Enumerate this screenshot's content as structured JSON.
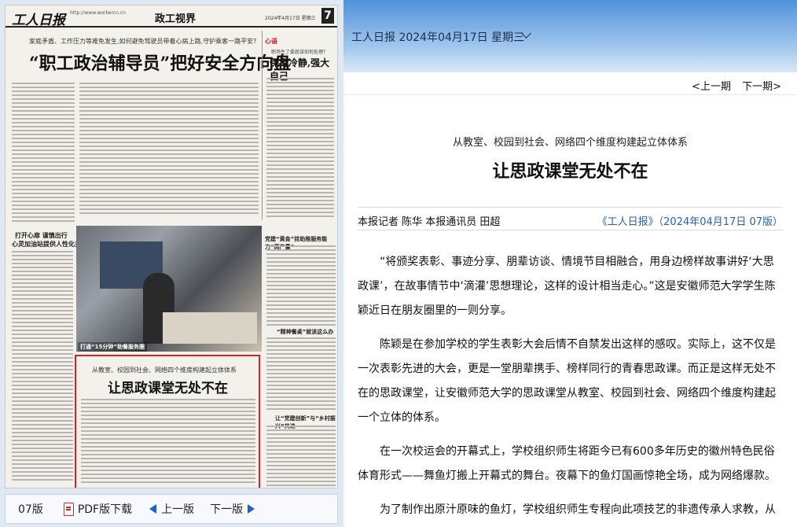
{
  "newspaper": {
    "masthead": "工人日报",
    "masthead_small": "http://www.workercn.cn",
    "section": "政工视界",
    "date": "2024年4月17日 星期三",
    "page_number": "7",
    "kicker": "家庭矛盾、工作压力等难免发生,如何避免驾驶员带着心病上路,守护乘客一路平安?",
    "main_headline": "“职工政治辅导员”把好安全方向盘",
    "right_heart": "心语",
    "right_sub": "职场生了委屈该如何处理?",
    "right_big": "保持冷静,强大自己",
    "left_head": "打开心扉 谨慎出行",
    "left_head2": "心灵加油站提供人性化关怀",
    "photo_caption": "打通“15分钟”助餐服务圈",
    "mid_head": "党建“黄金”挂助推服务能力“高产量”",
    "mid_head2": "“精神餐桌”就该这么办",
    "mid_head3": "让“党建创新”与“乡村振兴”共进",
    "box_kicker": "从教室、校园到社会、网络四个维度构建起立体体系",
    "box_title": "让思政课堂无处不在"
  },
  "left_nav": {
    "edition": "07版",
    "pdf_label": "PDF版下载",
    "prev_label": "上一版",
    "next_label": "下一版"
  },
  "header": {
    "date_title": "工人日报 2024年04月17日 星期三"
  },
  "pager": {
    "prev": "<上一期",
    "next": "下一期>"
  },
  "article": {
    "kicker": "从教室、校园到社会、网络四个维度构建起立体体系",
    "headline": "让思政课堂无处不在",
    "author": "本报记者 陈华 本报通讯员 田超",
    "source": "《工人日报》（2024年04月17日 07版）",
    "paragraphs": [
      "“将颁奖表彰、事迹分享、朋辈访谈、情境节目相融合，用身边榜样故事讲好‘大思政课’，在故事情节中‘滴灌’思想理论，这样的设计相当走心。”这是安徽师范大学学生陈颖近日在朋友圈里的一则分享。",
      "陈颖是在参加学校的学生表彰大会后情不自禁发出这样的感叹。实际上，这不仅是一次表彰先进的大会，更是一堂朋辈携手、榜样同行的青春思政课。而正是这样无处不在的思政课堂，让安徽师范大学的思政课堂从教室、校园到社会、网络四个维度构建起一个立体的体系。",
      "在一次校运会的开幕式上，学校组织师生将距今已有600多年历史的徽州特色民俗体育形式——舞鱼灯搬上开幕式的舞台。夜幕下的鱼灯国画惊艳全场，成为网络爆款。",
      "为了制作出原汁原味的鱼灯，学校组织师生专程向此项技艺的非遗传承人求教，从"
    ]
  }
}
